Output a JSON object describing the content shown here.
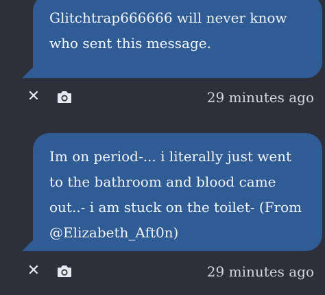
{
  "messages": [
    {
      "text": "Glitchtrap666666 will never know who sent this message.",
      "timestamp": "29 minutes ago",
      "icons": [
        "close-icon",
        "camera-icon"
      ]
    },
    {
      "text": "Im on period-... i literally just went to the bathroom and blood came out..- i am stuck on the toilet- (From @Elizabeth_Aft0n)",
      "timestamp": "29 minutes ago",
      "icons": [
        "close-icon",
        "camera-icon"
      ]
    }
  ],
  "colors": {
    "background": "#2d2f3b",
    "bubble": "#2f5c94",
    "text": "#f2f4f8",
    "meta": "#d4d6de"
  },
  "close_glyph": "✕"
}
